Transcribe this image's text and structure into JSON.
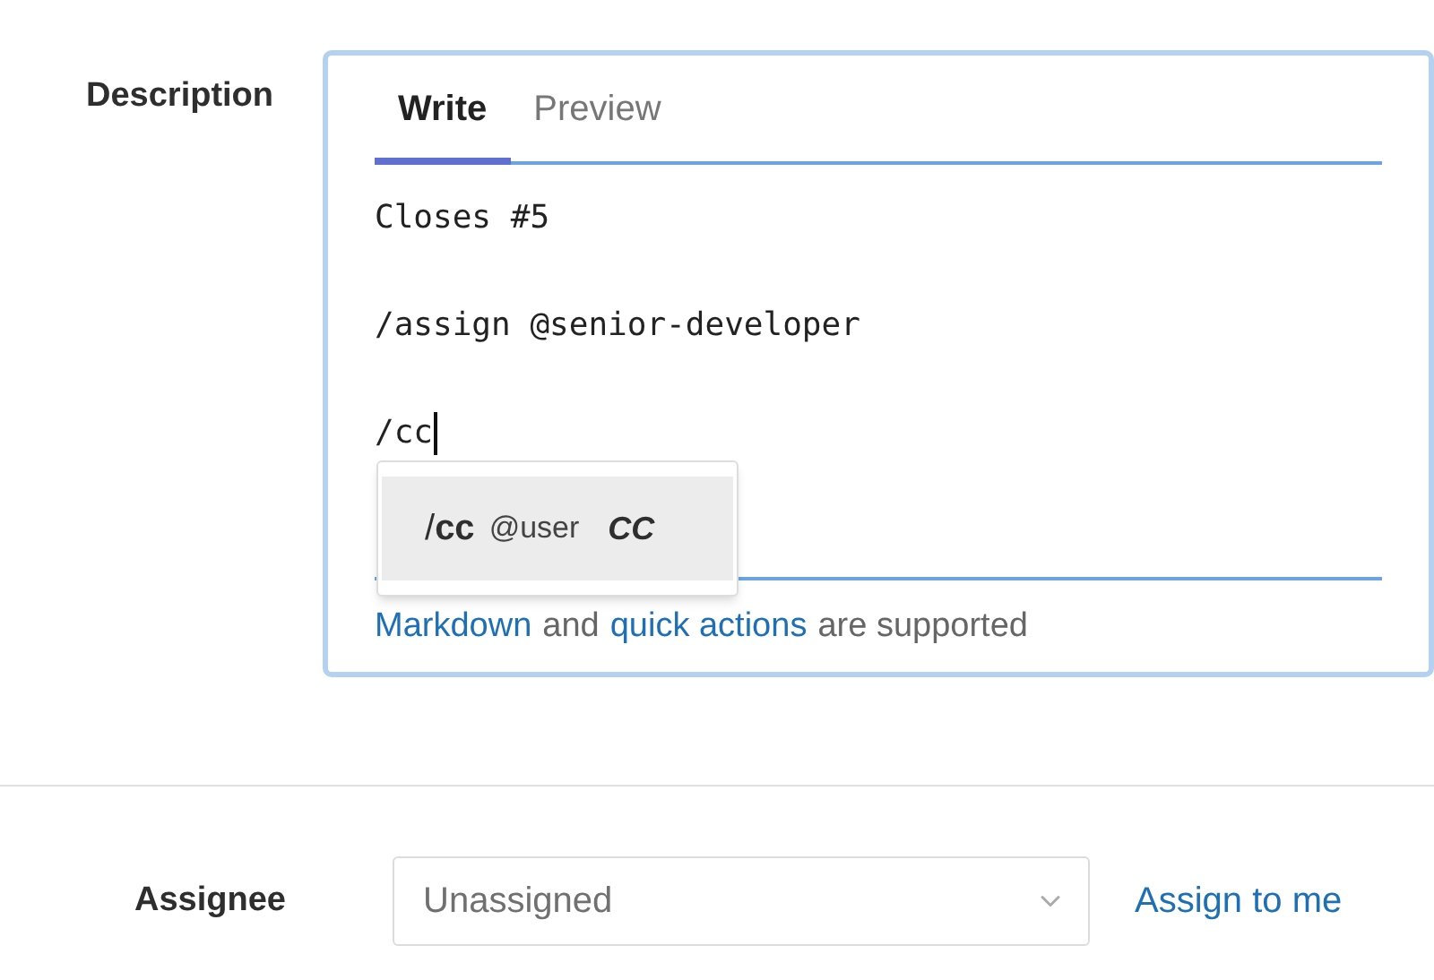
{
  "description": {
    "label": "Description",
    "tabs": [
      {
        "label": "Write",
        "selected": true
      },
      {
        "label": "Preview",
        "selected": false
      }
    ],
    "value": "Closes #5\n\n/assign @senior-developer\n\n/cc",
    "autocomplete": [
      {
        "command": "/**cc**",
        "argument": "@user",
        "hint": "CC",
        "selected": true
      }
    ],
    "footer": {
      "link_1": "Markdown",
      "text_1": "and",
      "link_2": "quick actions",
      "text_2": "are supported"
    }
  },
  "assignee": {
    "label": "Assignee",
    "placeholder": "Unassigned",
    "action": "Assign to me"
  }
}
